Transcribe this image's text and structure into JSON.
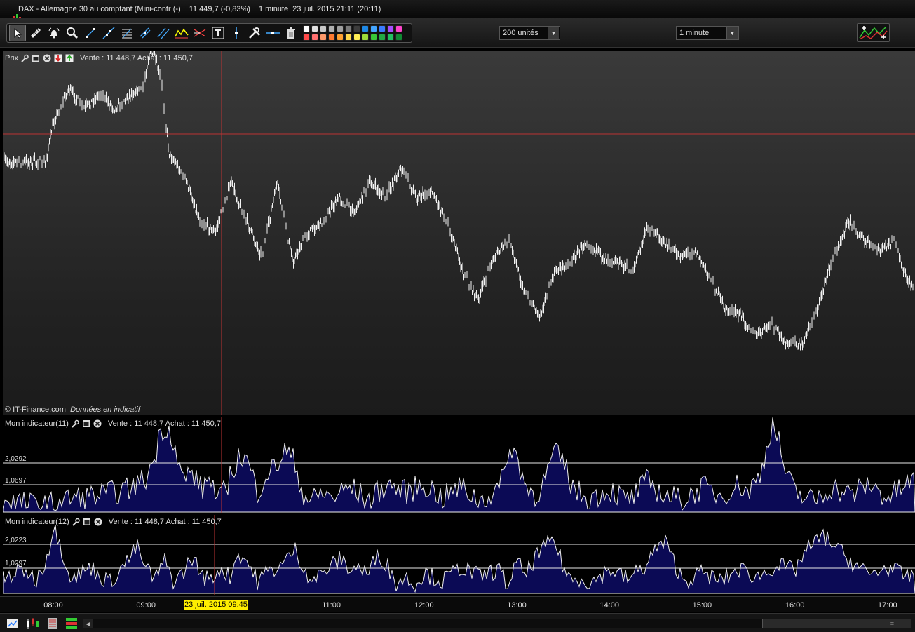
{
  "title": {
    "instrument": "DAX - Allemagne 30 au comptant (Mini-contr (-)",
    "price": "11 449,7 (-0,83%)",
    "interval": "1 minute",
    "datetime": "23 juil. 2015 21:11 (20:11)"
  },
  "toolbar": {
    "units_label": "200 unités",
    "interval_label": "1 minute",
    "tools": [
      "cursor",
      "ruler",
      "alarm",
      "zoom",
      "segment",
      "line",
      "fibonacci",
      "channel",
      "parallel",
      "pattern",
      "triangle",
      "text",
      "vertical-line",
      "settings",
      "horizontal-line",
      "trash"
    ],
    "palette": [
      "#ffffff",
      "#e0e0e0",
      "#c8c8c8",
      "#b0b0b0",
      "#a0a0a0",
      "#7a7a7a",
      "#3c3c3c",
      "#1e88e5",
      "#43a5ff",
      "#3a7bff",
      "#a64dff",
      "#ff44cc",
      "#ff4a4a",
      "#ff7070",
      "#ff9a6a",
      "#ff7a30",
      "#ffa030",
      "#ffd84a",
      "#ffee55",
      "#9ddc3a",
      "#38c838",
      "#22aa44",
      "#22c060",
      "#118833"
    ]
  },
  "price_panel": {
    "name": "Prix",
    "quote": "Vente : 11 448,7 Achat : 11 450,7",
    "credit_prefix": "© IT-Finance.com",
    "credit_italic": "Données en indicatif"
  },
  "indicator1": {
    "name": "Mon indicateur(11)",
    "quote": "Vente : 11 448,7 Achat : 11 450,7",
    "upper_level": "2,0292",
    "lower_level": "1,0697"
  },
  "indicator2": {
    "name": "Mon indicateur(12)",
    "quote": "Vente : 11 448,7 Achat : 11 450,7",
    "upper_level": "2,0223",
    "lower_level": "1,0297"
  },
  "time_axis": {
    "ticks": [
      "08:00",
      "09:00",
      "11:00",
      "12:00",
      "13:00",
      "14:00",
      "15:00",
      "16:00",
      "17:00"
    ],
    "cursor_label": "23 juil. 2015 09:45"
  },
  "chart_data": [
    {
      "type": "line",
      "title": "Prix",
      "series": [
        {
          "name": "DAX",
          "x": [
            "07:55",
            "08:00",
            "08:10",
            "08:20",
            "08:30",
            "08:40",
            "08:50",
            "08:58",
            "09:02",
            "09:05",
            "09:10",
            "09:15",
            "09:25",
            "09:35",
            "09:45",
            "09:55",
            "10:05",
            "10:15",
            "10:25",
            "10:35",
            "10:45",
            "10:55",
            "11:05",
            "11:15",
            "11:25",
            "11:35",
            "11:45",
            "11:55",
            "12:05",
            "12:15",
            "12:25",
            "12:35",
            "12:45",
            "12:55",
            "13:05",
            "13:15",
            "13:25",
            "13:35",
            "13:45",
            "13:55",
            "14:05",
            "14:15",
            "14:25",
            "14:35",
            "14:45",
            "14:55",
            "15:05",
            "15:15",
            "15:25",
            "15:35",
            "15:45",
            "15:55",
            "16:05",
            "16:15",
            "16:25",
            "16:35",
            "16:45",
            "16:55",
            "17:05",
            "17:10",
            "17:15"
          ],
          "values": [
            0.28,
            0.15,
            0.03,
            0.1,
            0.05,
            0.1,
            0.05,
            0.03,
            -0.08,
            -0.09,
            0.01,
            0.25,
            0.33,
            0.48,
            0.52,
            0.35,
            0.48,
            0.6,
            0.35,
            0.62,
            0.52,
            0.48,
            0.4,
            0.45,
            0.35,
            0.4,
            0.3,
            0.4,
            0.38,
            0.48,
            0.65,
            0.75,
            0.6,
            0.55,
            0.72,
            0.8,
            0.65,
            0.62,
            0.55,
            0.6,
            0.62,
            0.65,
            0.5,
            0.55,
            0.6,
            0.58,
            0.67,
            0.78,
            0.8,
            0.87,
            0.83,
            0.9,
            0.9,
            0.77,
            0.6,
            0.48,
            0.55,
            0.58,
            0.55,
            0.65,
            0.7
          ]
        }
      ]
    },
    {
      "type": "area",
      "title": "Mon indicateur(11)",
      "levels": [
        2.0292,
        1.0697
      ],
      "series": [
        {
          "name": "Mon indicateur(11)",
          "x_hours": [
            7.5,
            7.9,
            8.2,
            8.5,
            8.8,
            9.0,
            9.1,
            9.15,
            9.2,
            9.25,
            9.3,
            9.35,
            9.4,
            9.5,
            9.6,
            9.7,
            9.75,
            9.8,
            9.9,
            10.0,
            10.1,
            10.2,
            10.3,
            10.4,
            10.5,
            10.6,
            10.7,
            10.8,
            10.9,
            11.0,
            11.2,
            11.4,
            11.6,
            11.8,
            12.0,
            12.2,
            12.4,
            12.6,
            12.8,
            12.85,
            12.9,
            13.0,
            13.1,
            13.2,
            13.3,
            13.4,
            13.5,
            13.6,
            13.7,
            13.8,
            14.0,
            14.2,
            14.3,
            14.4,
            14.6,
            14.8,
            15.0,
            15.2,
            15.4,
            15.5,
            15.6,
            15.65,
            15.7,
            15.75,
            15.8,
            15.9,
            16.0,
            16.2,
            16.4,
            16.6,
            16.8,
            17.0,
            17.3
          ],
          "values": [
            0.4,
            0.2,
            0.5,
            0.6,
            0.8,
            1.2,
            2.0,
            2.8,
            3.1,
            2.9,
            2.6,
            1.6,
            1.2,
            1.4,
            0.8,
            1.3,
            0.5,
            0.4,
            1.2,
            2.0,
            1.8,
            0.7,
            1.4,
            1.6,
            2.2,
            1.8,
            0.6,
            0.4,
            0.7,
            0.5,
            0.9,
            0.4,
            1.0,
            0.7,
            1.0,
            0.5,
            0.9,
            0.4,
            0.8,
            1.2,
            2.2,
            2.0,
            0.9,
            0.6,
            1.1,
            2.1,
            1.8,
            0.9,
            0.6,
            0.5,
            0.8,
            0.4,
            0.7,
            1.1,
            0.6,
            0.4,
            0.9,
            0.6,
            1.0,
            0.7,
            1.2,
            1.6,
            2.4,
            3.1,
            2.9,
            1.4,
            0.7,
            0.4,
            0.9,
            0.6,
            1.0,
            0.5,
            1.2
          ]
        }
      ]
    },
    {
      "type": "area",
      "title": "Mon indicateur(12)",
      "levels": [
        2.0223,
        1.0297
      ],
      "series": [
        {
          "name": "Mon indicateur(12)",
          "x_hours": [
            7.5,
            7.7,
            7.8,
            7.9,
            7.95,
            8.0,
            8.05,
            8.1,
            8.2,
            8.4,
            8.6,
            8.8,
            8.9,
            9.0,
            9.1,
            9.2,
            9.3,
            9.4,
            9.5,
            9.6,
            9.7,
            9.8,
            9.9,
            10.0,
            10.1,
            10.2,
            10.3,
            10.5,
            10.6,
            10.7,
            10.8,
            10.9,
            11.1,
            11.2,
            11.3,
            11.4,
            11.5,
            11.6,
            11.7,
            11.8,
            11.9,
            12.0,
            12.2,
            12.4,
            12.6,
            12.8,
            12.9,
            13.0,
            13.1,
            13.2,
            13.3,
            13.4,
            13.5,
            13.6,
            13.7,
            13.8,
            14.0,
            14.2,
            14.4,
            14.5,
            14.6,
            14.7,
            14.8,
            15.0,
            15.2,
            15.4,
            15.6,
            15.8,
            16.0,
            16.1,
            16.2,
            16.3,
            16.4,
            16.5,
            16.6,
            16.8,
            17.0,
            17.2,
            17.4
          ],
          "values": [
            0.8,
            1.2,
            0.6,
            1.4,
            2.2,
            3.2,
            2.8,
            2.0,
            0.7,
            1.3,
            0.5,
            1.6,
            2.3,
            1.2,
            0.7,
            1.6,
            0.6,
            1.0,
            1.8,
            0.9,
            0.6,
            1.3,
            0.8,
            2.0,
            1.5,
            0.6,
            1.0,
            1.5,
            2.2,
            1.3,
            0.6,
            1.0,
            1.7,
            1.2,
            1.3,
            0.9,
            2.0,
            1.4,
            0.5,
            0.8,
            0.4,
            1.0,
            0.6,
            1.3,
            0.8,
            1.2,
            0.4,
            1.5,
            0.9,
            1.8,
            2.2,
            2.7,
            1.3,
            0.6,
            0.8,
            0.5,
            1.2,
            0.7,
            1.4,
            2.2,
            2.5,
            1.5,
            0.6,
            1.0,
            0.6,
            1.2,
            0.8,
            1.4,
            1.1,
            2.0,
            2.4,
            2.8,
            2.5,
            2.0,
            1.6,
            0.9,
            1.3,
            0.8,
            1.1
          ]
        }
      ]
    }
  ]
}
